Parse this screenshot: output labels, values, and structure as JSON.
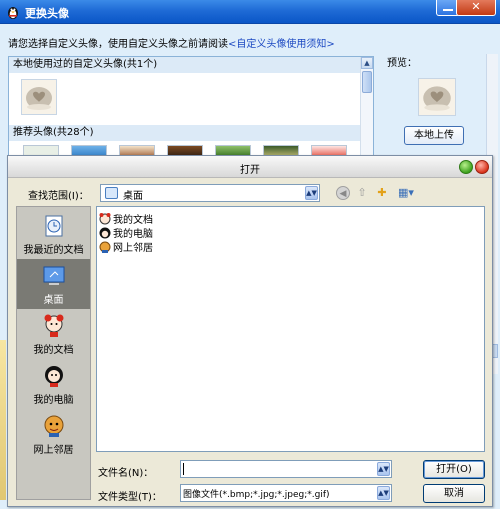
{
  "outer_window": {
    "title": "更换头像",
    "instruction_prefix": "请您选择自定义头像，使用自定义头像之前请阅读",
    "instruction_link": "<自定义头像使用须知>",
    "local_section_header": "本地使用过的自定义头像(共1个)",
    "recommended_section_header": "推荐头像(共28个)",
    "preview_label": "预览：",
    "upload_button": "本地上传",
    "close_glyph": "✕"
  },
  "dialog": {
    "title": "打开",
    "look_in_label": "查找范围(I)：",
    "look_in_value": "桌面",
    "places": [
      {
        "label": "我最近的文档"
      },
      {
        "label": "桌面"
      },
      {
        "label": "我的文档"
      },
      {
        "label": "我的电脑"
      },
      {
        "label": "网上邻居"
      }
    ],
    "files": [
      {
        "name": "我的文档"
      },
      {
        "name": "我的电脑"
      },
      {
        "name": "网上邻居"
      }
    ],
    "filename_label": "文件名(N)：",
    "filename_value": "",
    "filetype_label": "文件类型(T)：",
    "filetype_value": "图像文件(*.bmp;*.jpg;*.jpeg;*.gif)",
    "open_button": "打开(O)",
    "cancel_button": "取消"
  },
  "colors": {
    "titlebar_blue": "#1f6bd6",
    "panel_bg": "#dfeefa",
    "link_blue": "#1c49c2",
    "places_selected": "#7a7a74"
  }
}
